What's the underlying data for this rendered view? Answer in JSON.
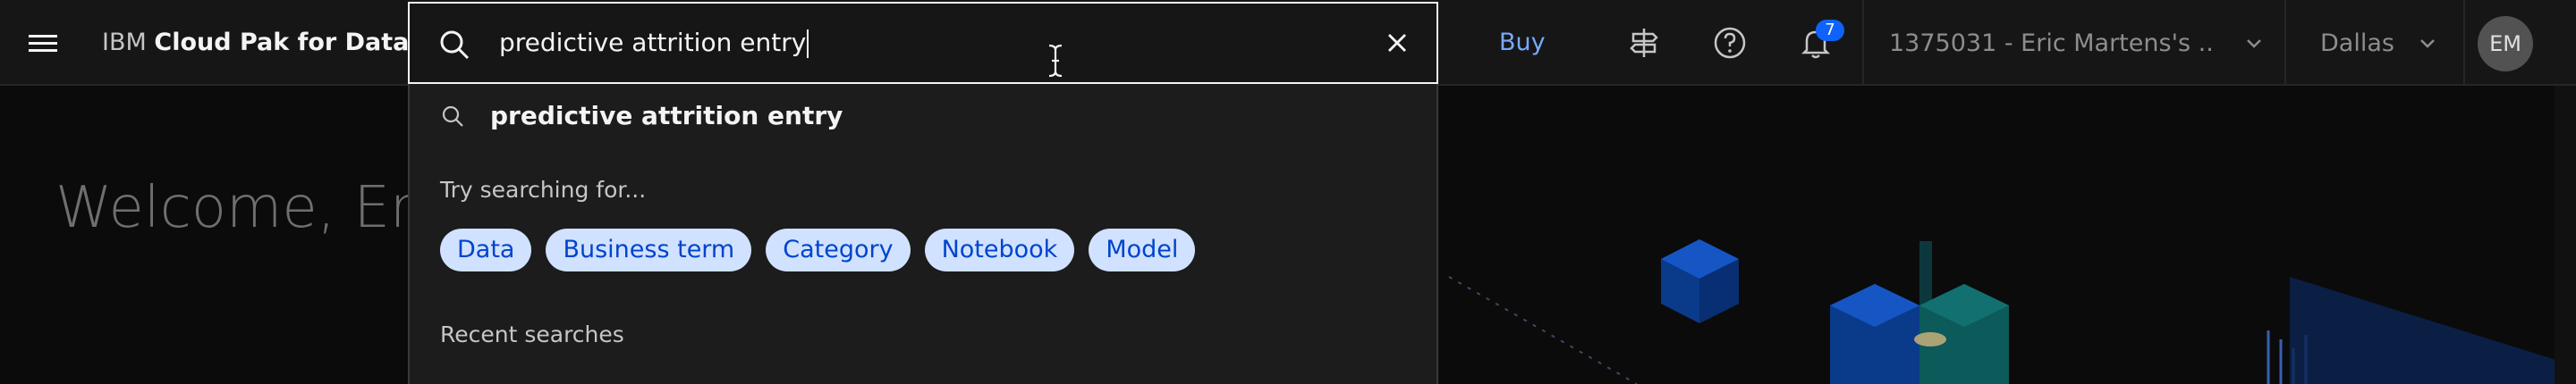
{
  "header": {
    "brand_prefix": "IBM",
    "brand_name": "Cloud Pak for Data",
    "buy_label": "Buy",
    "notification_count": "7",
    "account_label": "1375031 - Eric Martens's ...",
    "region_label": "Dallas",
    "avatar_initials": "EM",
    "icons": [
      "menu-icon",
      "signpost-icon",
      "help-icon",
      "notification-icon",
      "chevron-down-icon",
      "avatar"
    ]
  },
  "search": {
    "value": "predictive attrition entry",
    "suggestion": "predictive attrition entry",
    "try_label": "Try searching for...",
    "chips": [
      "Data",
      "Business term",
      "Category",
      "Notebook",
      "Model"
    ],
    "recent_label": "Recent searches"
  },
  "main": {
    "welcome": "Welcome, Eric"
  },
  "colors": {
    "accent": "#78a9ff",
    "chip_bg": "#d0e2ff",
    "chip_text": "#0043ce",
    "badge": "#0f62fe"
  }
}
